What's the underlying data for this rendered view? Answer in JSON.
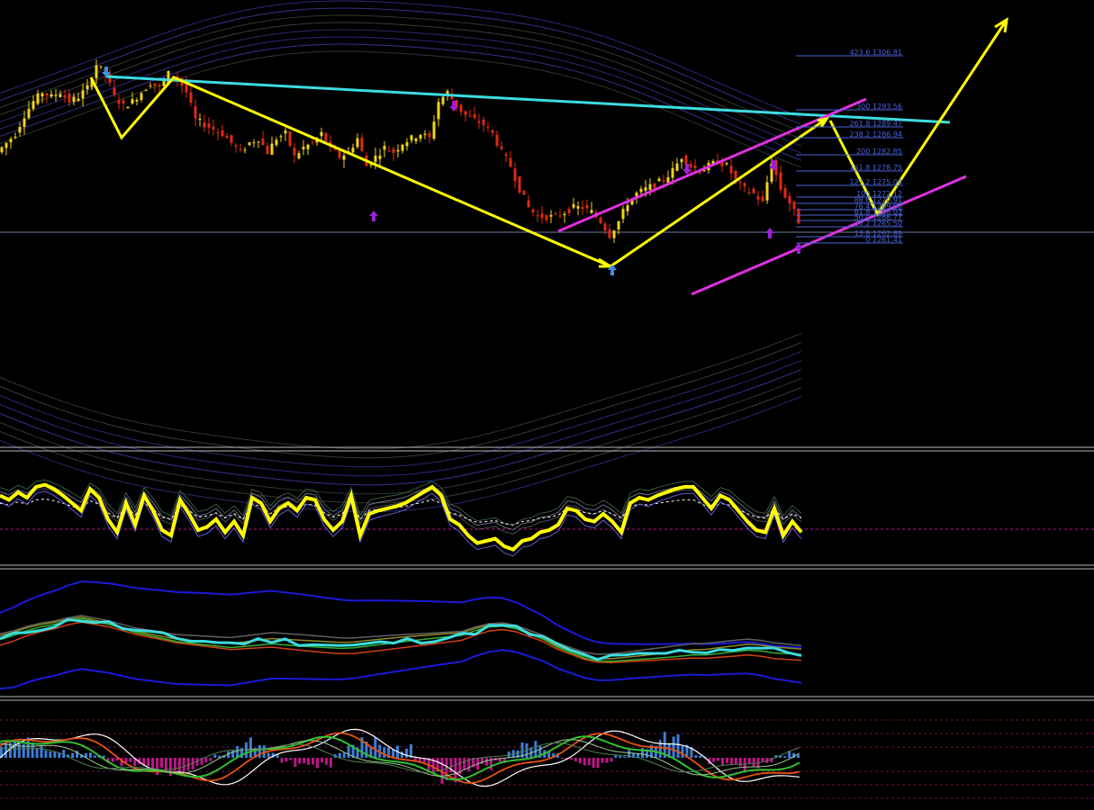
{
  "colors": {
    "background": "#000000",
    "candle_up": "#f2d21b",
    "candle_down": "#e02a10",
    "zigzag": "#ffff00",
    "trendline": "#3cdce0",
    "channel": "#e030e0",
    "fib": "#4a62d8",
    "fractal": "#9a20d8",
    "fractal_blue": "#3b8fe8",
    "separator": "#b8b8b8",
    "histogram_up": "#3c7fd8",
    "histogram_down": "#c0148c"
  },
  "chart_data": [
    {
      "type": "candlestick",
      "panel": "main",
      "ylim": [
        1215,
        1312
      ],
      "fibonacci_levels": [
        {
          "ratio": "423.6",
          "price": "1306.81"
        },
        {
          "ratio": "300",
          "price": "1293.56"
        },
        {
          "ratio": "261.8",
          "price": "1289.47"
        },
        {
          "ratio": "238.2",
          "price": "1286.94"
        },
        {
          "ratio": "200",
          "price": "1282.85"
        },
        {
          "ratio": "161.8",
          "price": "1278.75"
        },
        {
          "ratio": "127.2",
          "price": "1275.04"
        },
        {
          "ratio": "100",
          "price": "1272.12"
        },
        {
          "ratio": "88.6",
          "price": "1270.91"
        },
        {
          "ratio": "76.4",
          "price": "1269.60"
        },
        {
          "ratio": "61.8",
          "price": "1268.03"
        },
        {
          "ratio": "50.0",
          "price": "1266.77"
        },
        {
          "ratio": "38.2",
          "price": "1265.50"
        },
        {
          "ratio": "13.8",
          "price": "1262.89"
        },
        {
          "ratio": "0",
          "price": "1261.41"
        }
      ],
      "close_path": [
        [
          0,
          1279
        ],
        [
          10,
          1281
        ],
        [
          20,
          1283
        ],
        [
          30,
          1287
        ],
        [
          40,
          1290
        ],
        [
          50,
          1292
        ],
        [
          60,
          1291
        ],
        [
          70,
          1292
        ],
        [
          80,
          1290
        ],
        [
          90,
          1291
        ],
        [
          100,
          1293
        ],
        [
          110,
          1298
        ],
        [
          120,
          1296
        ],
        [
          130,
          1291
        ],
        [
          140,
          1289
        ],
        [
          150,
          1290
        ],
        [
          160,
          1292
        ],
        [
          170,
          1294
        ],
        [
          180,
          1293
        ],
        [
          190,
          1296
        ],
        [
          200,
          1295
        ],
        [
          210,
          1292
        ],
        [
          220,
          1286
        ],
        [
          230,
          1285
        ],
        [
          240,
          1284
        ],
        [
          250,
          1283
        ],
        [
          260,
          1281
        ],
        [
          270,
          1279
        ],
        [
          280,
          1281
        ],
        [
          290,
          1282
        ],
        [
          300,
          1279
        ],
        [
          310,
          1282
        ],
        [
          320,
          1283
        ],
        [
          330,
          1278
        ],
        [
          340,
          1280
        ],
        [
          350,
          1281
        ],
        [
          360,
          1283
        ],
        [
          370,
          1280
        ],
        [
          380,
          1278
        ],
        [
          390,
          1279
        ],
        [
          400,
          1282
        ],
        [
          410,
          1276
        ],
        [
          420,
          1278
        ],
        [
          430,
          1280
        ],
        [
          440,
          1279
        ],
        [
          450,
          1281
        ],
        [
          460,
          1282
        ],
        [
          470,
          1283
        ],
        [
          480,
          1282
        ],
        [
          490,
          1290
        ],
        [
          500,
          1292
        ],
        [
          510,
          1289
        ],
        [
          520,
          1287
        ],
        [
          530,
          1286
        ],
        [
          540,
          1285
        ],
        [
          550,
          1283
        ],
        [
          560,
          1279
        ],
        [
          570,
          1276
        ],
        [
          580,
          1271
        ],
        [
          590,
          1267
        ],
        [
          600,
          1265
        ],
        [
          610,
          1265
        ],
        [
          620,
          1265
        ],
        [
          630,
          1266
        ],
        [
          640,
          1267
        ],
        [
          650,
          1267
        ],
        [
          660,
          1266
        ],
        [
          670,
          1264
        ],
        [
          680,
          1261
        ],
        [
          690,
          1264
        ],
        [
          700,
          1268
        ],
        [
          710,
          1270
        ],
        [
          720,
          1271
        ],
        [
          730,
          1272
        ],
        [
          740,
          1273
        ],
        [
          750,
          1275
        ],
        [
          760,
          1278
        ],
        [
          770,
          1276
        ],
        [
          780,
          1275
        ],
        [
          790,
          1276
        ],
        [
          800,
          1277
        ],
        [
          810,
          1276
        ],
        [
          820,
          1273
        ],
        [
          830,
          1271
        ],
        [
          840,
          1270
        ],
        [
          850,
          1268
        ],
        [
          860,
          1277
        ],
        [
          870,
          1271
        ],
        [
          880,
          1268
        ],
        [
          890,
          1264
        ]
      ]
    },
    {
      "type": "line",
      "panel": "oscillator",
      "ylim": [
        0,
        100
      ],
      "series": [
        {
          "color": "#ffff00",
          "values": [
            62,
            58,
            65,
            60,
            70,
            72,
            68,
            62,
            55,
            48,
            68,
            60,
            40,
            28,
            55,
            35,
            62,
            48,
            30,
            25,
            58,
            45,
            30,
            33,
            40,
            28,
            38,
            25,
            60,
            55,
            38,
            50,
            55,
            48,
            60,
            58,
            40,
            30,
            38,
            62,
            25,
            45,
            48,
            50,
            52,
            55,
            60,
            65,
            70,
            62,
            40,
            35,
            25,
            18,
            20,
            22,
            15,
            12,
            20,
            22,
            28,
            30,
            35,
            50,
            48,
            40,
            38,
            45,
            38,
            28,
            55,
            60,
            58,
            62,
            65,
            68,
            70,
            70,
            60,
            50,
            62,
            58,
            48,
            38,
            30,
            28,
            50,
            25,
            38,
            28
          ]
        }
      ]
    },
    {
      "type": "line",
      "panel": "bands",
      "ylim": [
        0,
        100
      ],
      "series": [
        {
          "color": "#3cdce0",
          "values": [
            45,
            48,
            52,
            55,
            57,
            60,
            62,
            60,
            58,
            55,
            52,
            50,
            48,
            46,
            45,
            44,
            43,
            42,
            43,
            44,
            45,
            44,
            43,
            42,
            41,
            40,
            40,
            41,
            42,
            43,
            44,
            45,
            46,
            47,
            48,
            52,
            55,
            56,
            54,
            50,
            46,
            40,
            36,
            32,
            30,
            30,
            31,
            32,
            33,
            34,
            35,
            36,
            36,
            37,
            38,
            39,
            38,
            36,
            35,
            34
          ]
        }
      ]
    },
    {
      "type": "bar",
      "panel": "macd",
      "ylim": [
        -100,
        100
      ],
      "series": [
        {
          "color": "#3c7fd8",
          "values": [
            30,
            35,
            40,
            30,
            25,
            15,
            10,
            5,
            -10,
            -20,
            -30,
            -40,
            -35,
            -30,
            -25,
            -15,
            10,
            30,
            40,
            25,
            10,
            -10,
            -25,
            -30,
            -20,
            10,
            25,
            40,
            50,
            40,
            30,
            -10,
            -30,
            -50,
            -55,
            -45,
            -30,
            -10,
            15,
            30,
            35,
            20,
            -5,
            -15,
            -20,
            -10,
            5,
            20,
            40,
            55,
            45,
            25,
            5,
            -15,
            -25,
            -30,
            -20,
            -10,
            5,
            15
          ]
        }
      ]
    }
  ]
}
